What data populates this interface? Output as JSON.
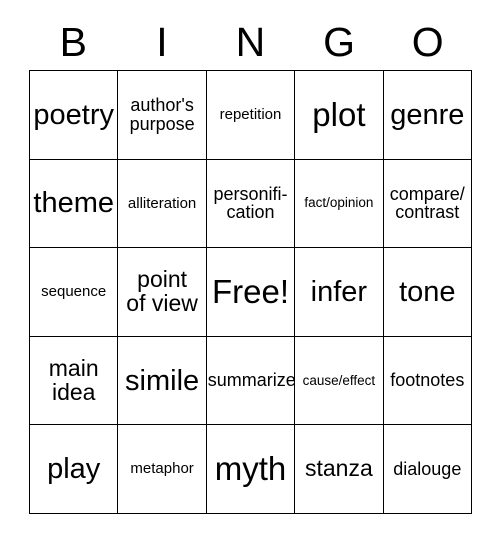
{
  "card": {
    "header_letters": [
      "B",
      "I",
      "N",
      "G",
      "O"
    ],
    "columns": 5,
    "rows": 5,
    "colors": {
      "background": "#ffffff",
      "border": "#000000",
      "text": "#000000"
    },
    "cells": [
      [
        {
          "label": "poetry",
          "size": "lg"
        },
        {
          "label": "author's\npurpose",
          "size": "sm"
        },
        {
          "label": "repetition",
          "size": "xs"
        },
        {
          "label": "plot",
          "size": "xl"
        },
        {
          "label": "genre",
          "size": "lg"
        }
      ],
      [
        {
          "label": "theme",
          "size": "lg"
        },
        {
          "label": "alliteration",
          "size": "xs"
        },
        {
          "label": "personifi-\ncation",
          "size": "sm"
        },
        {
          "label": "fact/opinion",
          "size": "xxs"
        },
        {
          "label": "compare/\ncontrast",
          "size": "sm"
        }
      ],
      [
        {
          "label": "sequence",
          "size": "xs"
        },
        {
          "label": "point\nof view",
          "size": "md"
        },
        {
          "label": "Free!",
          "size": "xl"
        },
        {
          "label": "infer",
          "size": "lg"
        },
        {
          "label": "tone",
          "size": "lg"
        }
      ],
      [
        {
          "label": "main\nidea",
          "size": "md"
        },
        {
          "label": "simile",
          "size": "lg"
        },
        {
          "label": "summarize",
          "size": "sm"
        },
        {
          "label": "cause/effect",
          "size": "xxs"
        },
        {
          "label": "footnotes",
          "size": "sm"
        }
      ],
      [
        {
          "label": "play",
          "size": "lg"
        },
        {
          "label": "metaphor",
          "size": "xs"
        },
        {
          "label": "myth",
          "size": "xl"
        },
        {
          "label": "stanza",
          "size": "md"
        },
        {
          "label": "dialouge",
          "size": "sm"
        }
      ]
    ]
  }
}
